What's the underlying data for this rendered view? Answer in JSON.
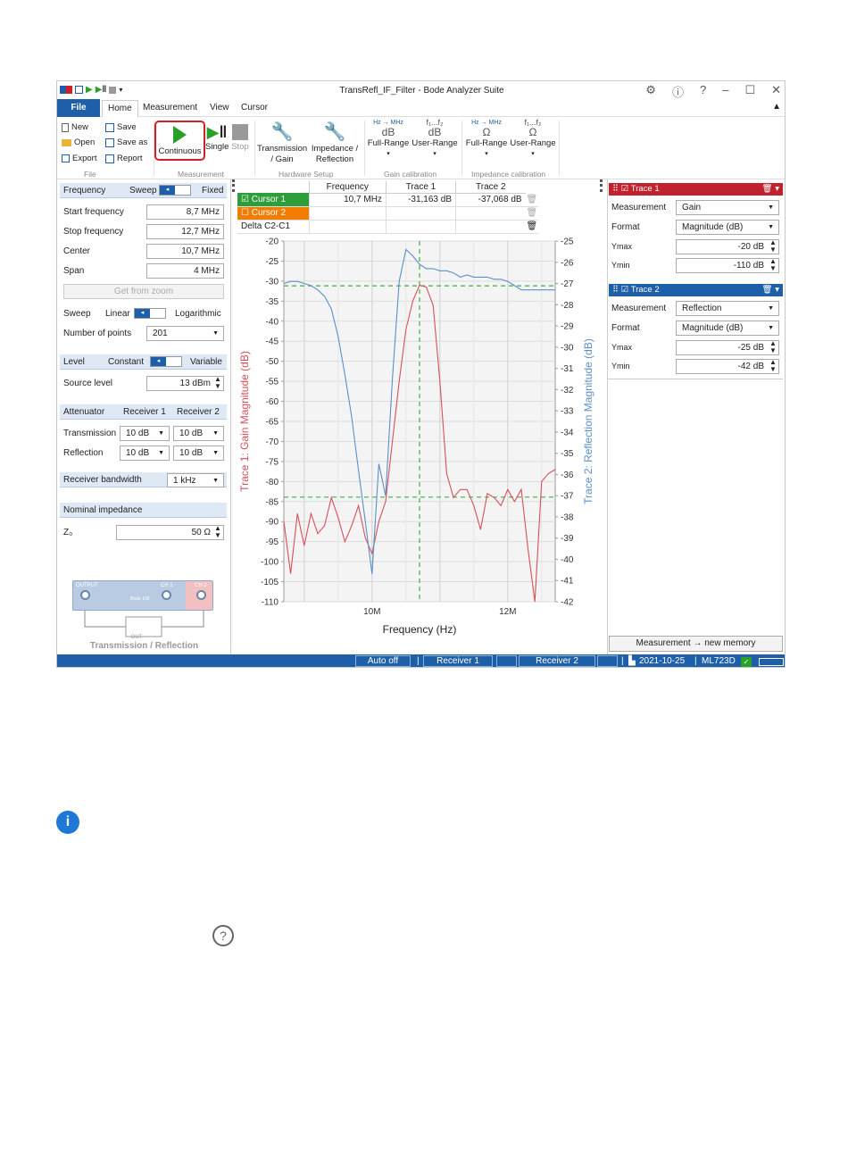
{
  "window": {
    "title": "TransRefl_IF_Filter - Bode Analyzer Suite"
  },
  "menu": {
    "file": "File",
    "tabs": [
      "Home",
      "Measurement",
      "View",
      "Cursor"
    ]
  },
  "ribbon": {
    "file_group": {
      "new": "New",
      "open": "Open",
      "export": "Export",
      "save": "Save",
      "save_as": "Save as",
      "report": "Report",
      "label": "File"
    },
    "measurement_group": {
      "continuous": "Continuous",
      "single": "Single",
      "stop": "Stop",
      "label": "Measurement"
    },
    "hardware_group": {
      "transmission": "Transmission",
      "transmission2": "/ Gain",
      "impedance": "Impedance /",
      "impedance2": "Reflection",
      "label": "Hardware Setup"
    },
    "gain_cal": {
      "full_range": "Full-Range",
      "user_range": "User-Range",
      "unit_db": "dB",
      "label": "Gain calibration"
    },
    "imp_cal": {
      "full_range": "Full-Range",
      "user_range": "User-Range",
      "unit_ohm": "Ω",
      "label": "Impedance calibration"
    },
    "hz_mhz": "Hz → MHz",
    "f_range": "f₁...f₂"
  },
  "left_panel": {
    "frequency": {
      "label": "Frequency",
      "sweep": "Sweep",
      "fixed": "Fixed"
    },
    "start_frequency": {
      "label": "Start frequency",
      "value": "8,7 MHz"
    },
    "stop_frequency": {
      "label": "Stop frequency",
      "value": "12,7 MHz"
    },
    "center": {
      "label": "Center",
      "value": "10,7 MHz"
    },
    "span": {
      "label": "Span",
      "value": "4 MHz"
    },
    "get_from_zoom": "Get from zoom",
    "sweep": {
      "label": "Sweep",
      "linear": "Linear",
      "log": "Logarithmic"
    },
    "points": {
      "label": "Number of points",
      "value": "201"
    },
    "level": {
      "label": "Level",
      "constant": "Constant",
      "variable": "Variable"
    },
    "source_level": {
      "label": "Source level",
      "value": "13 dBm"
    },
    "attenuator": {
      "label": "Attenuator",
      "r1": "Receiver 1",
      "r2": "Receiver 2"
    },
    "transmission": {
      "label": "Transmission",
      "v1": "10 dB",
      "v2": "10 dB"
    },
    "reflection": {
      "label": "Reflection",
      "v1": "10 dB",
      "v2": "10 dB"
    },
    "rbw": {
      "label": "Receiver bandwidth",
      "value": "1 kHz"
    },
    "impedance": {
      "label": "Nominal impedance",
      "z0": "Z₀",
      "value": "50 Ω"
    },
    "diagram": {
      "output": "OUTPUT",
      "ch1": "CH 1",
      "ch2": "CH 2",
      "dut": "DUT",
      "caption": "Transmission / Reflection",
      "brand": "Bode 100"
    }
  },
  "cursor_table": {
    "headers": [
      "",
      "Frequency",
      "Trace 1",
      "Trace 2"
    ],
    "rows": [
      {
        "name": "Cursor 1",
        "freq": "10,7 MHz",
        "t1": "-31,163 dB",
        "t2": "-37,068 dB"
      },
      {
        "name": "Cursor 2",
        "freq": "",
        "t1": "",
        "t2": ""
      },
      {
        "name": "Delta C2-C1",
        "freq": "",
        "t1": "",
        "t2": ""
      }
    ]
  },
  "right_panel": {
    "trace1": {
      "title": "Trace 1",
      "measurement_label": "Measurement",
      "measurement": "Gain",
      "format_label": "Format",
      "format": "Magnitude (dB)",
      "ymax_label": "Ymax",
      "ymax": "-20 dB",
      "ymin_label": "Ymin",
      "ymin": "-110 dB"
    },
    "trace2": {
      "title": "Trace 2",
      "measurement_label": "Measurement",
      "measurement": "Reflection",
      "format_label": "Format",
      "format": "Magnitude (dB)",
      "ymax_label": "Ymax",
      "ymax": "-25 dB",
      "ymin_label": "Ymin",
      "ymin": "-42 dB"
    },
    "memory_button": "Measurement → new memory"
  },
  "status_bar": {
    "auto": "Auto off",
    "r1": "Receiver 1",
    "r2": "Receiver 2",
    "date": "2021-10-25",
    "device": "ML723D"
  },
  "colors": {
    "accent": "#1d5fa8",
    "trace1": "#d6505a",
    "trace2": "#5b8fc9",
    "trace1_header": "#c0232f",
    "cursor2": "#f07d00",
    "highlight": "#d21e28",
    "cursor_line": "#3cb043"
  },
  "chart_data": {
    "type": "line",
    "xlabel": "Frequency (Hz)",
    "ylabel": "Trace 1: Gain Magnitude (dB)",
    "y2label": "Trace 2: Reflection Magnitude (dB)",
    "xlim": [
      8700000,
      12700000
    ],
    "ylim": [
      -110,
      -20
    ],
    "y2lim": [
      -42,
      -25
    ],
    "x_ticks": [
      "10M",
      "12M"
    ],
    "y_ticks": [
      -20,
      -25,
      -30,
      -35,
      -40,
      -45,
      -50,
      -55,
      -60,
      -65,
      -70,
      -75,
      -80,
      -85,
      -90,
      -95,
      -100,
      -105,
      -110
    ],
    "y2_ticks": [
      -25,
      -26,
      -27,
      -28,
      -29,
      -30,
      -31,
      -32,
      -33,
      -34,
      -35,
      -36,
      -37,
      -38,
      -39,
      -40,
      -41,
      -42
    ],
    "cursor_x": 10700000,
    "cursor_y1": -31.163,
    "cursor_y2": -37.068,
    "series": [
      {
        "name": "Trace 1",
        "axis": "left",
        "x": [
          8700000,
          8800000,
          8900000,
          9000000,
          9100000,
          9200000,
          9300000,
          9400000,
          9500000,
          9600000,
          9700000,
          9800000,
          9900000,
          10000000,
          10100000,
          10200000,
          10300000,
          10400000,
          10500000,
          10600000,
          10700000,
          10800000,
          10900000,
          11000000,
          11100000,
          11200000,
          11300000,
          11400000,
          11500000,
          11600000,
          11700000,
          11800000,
          11900000,
          12000000,
          12100000,
          12200000,
          12300000,
          12400000,
          12500000,
          12600000,
          12700000
        ],
        "y": [
          -90,
          -103,
          -88,
          -96,
          -88,
          -93,
          -91,
          -84,
          -89,
          -95,
          -91,
          -86,
          -94,
          -98,
          -90,
          -85,
          -70,
          -55,
          -42,
          -35,
          -31,
          -31.5,
          -36,
          -55,
          -78,
          -84,
          -82,
          -82,
          -86,
          -92,
          -83,
          -84,
          -86,
          -82,
          -85,
          -82,
          -97,
          -110,
          -80,
          -78,
          -77
        ]
      },
      {
        "name": "Trace 2",
        "axis": "right",
        "x": [
          8700000,
          8800000,
          8900000,
          9000000,
          9100000,
          9200000,
          9300000,
          9400000,
          9500000,
          9600000,
          9700000,
          9800000,
          9900000,
          10000000,
          10100000,
          10200000,
          10300000,
          10400000,
          10500000,
          10600000,
          10700000,
          10800000,
          10900000,
          11000000,
          11100000,
          11200000,
          11300000,
          11400000,
          11500000,
          11600000,
          11700000,
          11800000,
          11900000,
          12000000,
          12100000,
          12200000,
          12300000,
          12400000,
          12500000,
          12600000,
          12700000
        ],
        "y": [
          -27,
          -26.9,
          -26.9,
          -27,
          -27.1,
          -27.3,
          -27.6,
          -28.2,
          -29.5,
          -31.3,
          -33.3,
          -35.8,
          -38.2,
          -40.7,
          -35.5,
          -37,
          -31.5,
          -26.9,
          -25.4,
          -25.7,
          -26.1,
          -26.3,
          -26.3,
          -26.4,
          -26.4,
          -26.5,
          -26.7,
          -26.6,
          -26.7,
          -26.7,
          -26.7,
          -26.8,
          -26.8,
          -26.9,
          -27.1,
          -27.3,
          -27.3,
          -27.3,
          -27.3,
          -27.3,
          -27.3
        ]
      }
    ]
  }
}
